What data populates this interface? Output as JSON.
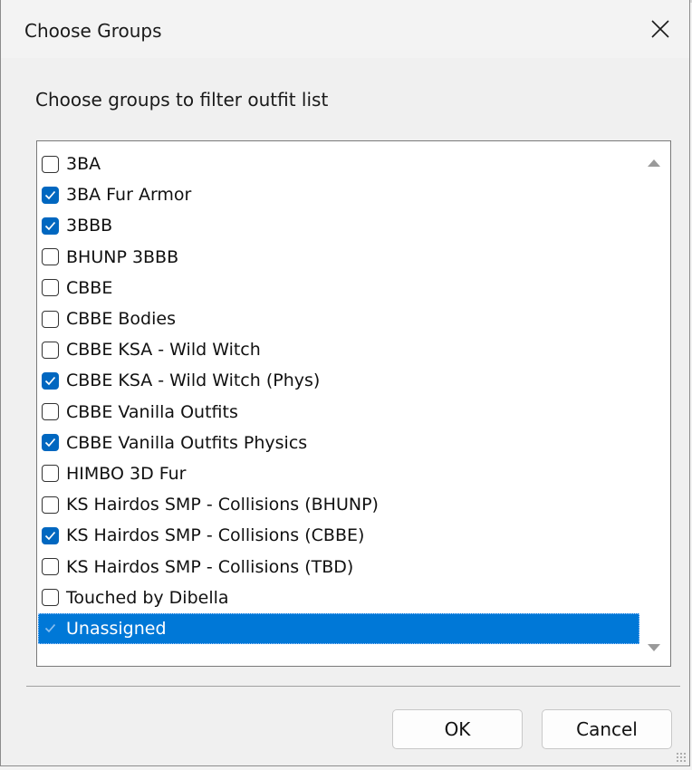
{
  "window": {
    "title": "Choose Groups",
    "close_icon": "close-icon"
  },
  "prompt": "Choose groups to filter outfit list",
  "groups": [
    {
      "label": "3BA",
      "checked": false,
      "selected": false
    },
    {
      "label": "3BA Fur Armor",
      "checked": true,
      "selected": false
    },
    {
      "label": "3BBB",
      "checked": true,
      "selected": false
    },
    {
      "label": "BHUNP 3BBB",
      "checked": false,
      "selected": false
    },
    {
      "label": "CBBE",
      "checked": false,
      "selected": false
    },
    {
      "label": "CBBE Bodies",
      "checked": false,
      "selected": false
    },
    {
      "label": "CBBE KSA - Wild Witch",
      "checked": false,
      "selected": false
    },
    {
      "label": "CBBE KSA - Wild Witch (Phys)",
      "checked": true,
      "selected": false
    },
    {
      "label": "CBBE Vanilla Outfits",
      "checked": false,
      "selected": false
    },
    {
      "label": "CBBE Vanilla Outfits Physics",
      "checked": true,
      "selected": false
    },
    {
      "label": "HIMBO 3D Fur",
      "checked": false,
      "selected": false
    },
    {
      "label": "KS Hairdos SMP - Collisions (BHUNP)",
      "checked": false,
      "selected": false
    },
    {
      "label": "KS Hairdos SMP - Collisions (CBBE)",
      "checked": true,
      "selected": false
    },
    {
      "label": "KS Hairdos SMP - Collisions (TBD)",
      "checked": false,
      "selected": false
    },
    {
      "label": "Touched by Dibella",
      "checked": false,
      "selected": false
    },
    {
      "label": "Unassigned",
      "checked": true,
      "selected": true
    }
  ],
  "buttons": {
    "ok_label": "OK",
    "cancel_label": "Cancel"
  },
  "colors": {
    "accent": "#0067c0",
    "selection": "#0078d7"
  }
}
